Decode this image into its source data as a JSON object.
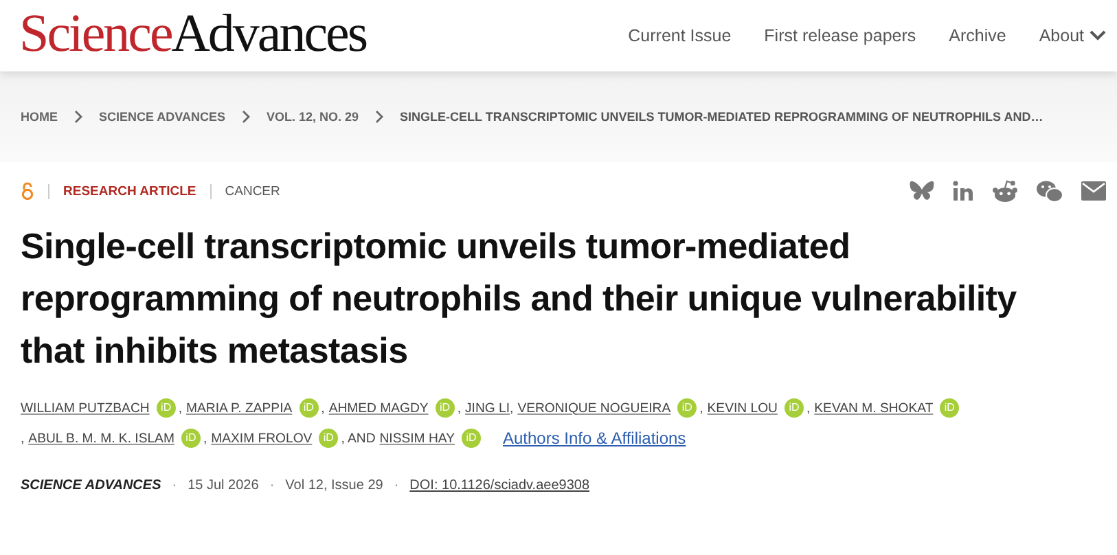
{
  "header": {
    "logo": {
      "part_1": "Science",
      "part_2": "Advances"
    },
    "nav": [
      {
        "label": "Current Issue",
        "has_menu": false
      },
      {
        "label": "First release papers",
        "has_menu": false
      },
      {
        "label": "Archive",
        "has_menu": false
      },
      {
        "label": "About",
        "has_menu": true
      }
    ]
  },
  "breadcrumbs": [
    "HOME",
    "SCIENCE ADVANCES",
    "VOL. 12, NO. 29",
    "SINGLE-CELL TRANSCRIPTOMIC UNVEILS TUMOR-MEDIATED REPROGRAMMING OF NEUTROPHILS AND…"
  ],
  "article": {
    "open_access": true,
    "type": "RESEARCH ARTICLE",
    "subject": "CANCER",
    "share": [
      {
        "kind": "bluesky"
      },
      {
        "kind": "linkedin"
      },
      {
        "kind": "reddit"
      },
      {
        "kind": "wechat"
      },
      {
        "kind": "email"
      }
    ],
    "title": "Single-cell transcriptomic unveils tumor-mediated reprogramming of neutrophils and their unique vulnerability that inhibits metastasis",
    "authors": [
      {
        "name": "WILLIAM PUTZBACH",
        "orcid_badge": "iD"
      },
      {
        "prefix": ",",
        "name": "MARIA P. ZAPPIA",
        "orcid_badge": "iD"
      },
      {
        "prefix": ",",
        "name": "AHMED MAGDY",
        "orcid_badge": "iD"
      },
      {
        "prefix": ",",
        "name": "JING LI"
      },
      {
        "prefix": ",",
        "name": "VERONIQUE NOGUEIRA",
        "orcid_badge": "iD"
      },
      {
        "prefix": ",",
        "name": "KEVIN LOU",
        "orcid_badge": "iD"
      },
      {
        "prefix": ",",
        "name": "KEVAN M. SHOKAT",
        "orcid_badge": "iD"
      },
      {
        "prefix": ",",
        "name": "ABUL B. M. M. K. ISLAM",
        "orcid_badge": "iD"
      },
      {
        "prefix": ",",
        "name": "MAXIM FROLOV",
        "orcid_badge": "iD"
      },
      {
        "prefix": ", AND",
        "name": "NISSIM HAY",
        "orcid_badge": "iD"
      }
    ],
    "affiliations_link": "Authors Info & Affiliations",
    "meta": [
      {
        "kind": "journal",
        "text": "SCIENCE ADVANCES"
      },
      {
        "kind": "separator",
        "text": "·"
      },
      {
        "kind": "date",
        "text": "15 Jul 2026"
      },
      {
        "kind": "separator",
        "text": "·"
      },
      {
        "kind": "issue",
        "text": "Vol 12, Issue 29"
      },
      {
        "kind": "separator",
        "text": "·"
      },
      {
        "kind": "doi",
        "text": "DOI: 10.1126/sciadv.aee9308"
      }
    ]
  }
}
